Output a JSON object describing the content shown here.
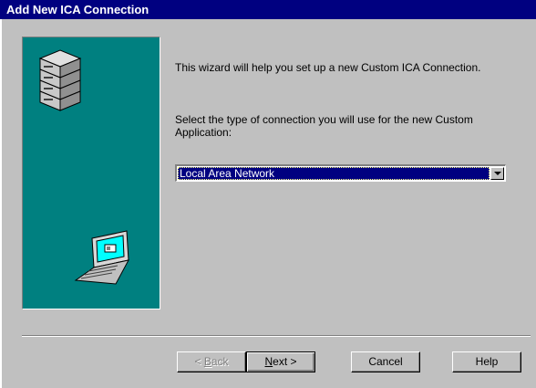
{
  "window": {
    "title": "Add New ICA Connection"
  },
  "intro_text": "This wizard will help you set up a new Custom ICA Connection.",
  "prompt_text": "Select the type of connection you will use for the new Custom Application:",
  "connection_type": {
    "selected": "Local Area Network"
  },
  "buttons": {
    "back": {
      "prefix": "< ",
      "key": "B",
      "rest": "ack",
      "enabled": false
    },
    "next": {
      "key": "N",
      "rest": "ext >"
    },
    "cancel": "Cancel",
    "help": "Help"
  },
  "icons": {
    "server": "server-stack-icon",
    "laptop": "laptop-icon"
  },
  "colors": {
    "titlebar": "#000080",
    "panel": "#008080",
    "face": "#c0c0c0",
    "selection": "#000080"
  }
}
